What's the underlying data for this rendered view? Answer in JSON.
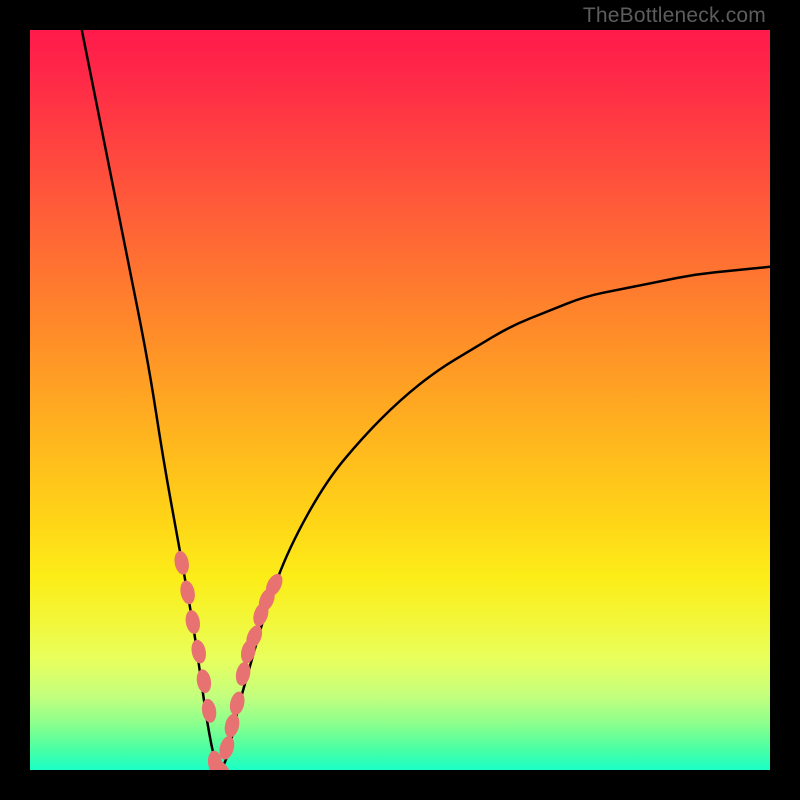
{
  "watermark": "TheBottleneck.com",
  "chart_data": {
    "type": "line",
    "title": "",
    "xlabel": "",
    "ylabel": "",
    "xlim": [
      0,
      100
    ],
    "ylim": [
      0,
      100
    ],
    "description": "Bottleneck V-curve: a sharp valley near x≈25 reaching y≈0, rising steeply to the left edge (x≈7,y≈100) and gradually toward the right (x≈100,y≈68). Background is a vertical spectral gradient from red (high bottleneck) to green (low).",
    "series": [
      {
        "name": "bottleneck-curve",
        "x": [
          7,
          10,
          13,
          16,
          18,
          20,
          22,
          23,
          24,
          25,
          26,
          27,
          28,
          30,
          32,
          35,
          40,
          45,
          50,
          55,
          60,
          65,
          70,
          75,
          80,
          85,
          90,
          95,
          100
        ],
        "y": [
          100,
          85,
          70,
          55,
          42,
          31,
          20,
          13,
          6,
          1,
          0,
          3,
          8,
          15,
          22,
          30,
          39,
          45,
          50,
          54,
          57,
          60,
          62,
          64,
          65,
          66,
          67,
          67.5,
          68
        ]
      },
      {
        "name": "highlighted-points",
        "type": "scatter",
        "x": [
          20.5,
          21.3,
          22.0,
          22.8,
          23.5,
          24.2,
          25.0,
          25.8,
          26.6,
          27.3,
          28.0,
          28.8,
          29.5,
          30.3,
          31.2,
          32.0,
          33.0
        ],
        "y": [
          28,
          24,
          20,
          16,
          12,
          8,
          1,
          0,
          3,
          6,
          9,
          13,
          16,
          18,
          21,
          23,
          25
        ]
      }
    ],
    "gradient_stops": [
      {
        "pos": 0.0,
        "color": "#ff1a4a"
      },
      {
        "pos": 0.5,
        "color": "#ffb21f"
      },
      {
        "pos": 0.8,
        "color": "#f2f73a"
      },
      {
        "pos": 1.0,
        "color": "#1affc6"
      }
    ]
  }
}
